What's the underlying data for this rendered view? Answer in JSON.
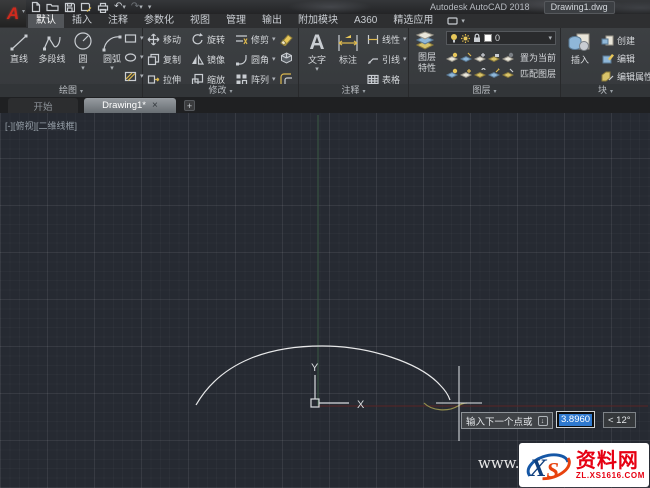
{
  "icons": {
    "logo_a": "A",
    "caret": "▾",
    "undo": "↶",
    "redo": "↷",
    "close": "×",
    "plus": "+",
    "down_arrow": "↓"
  },
  "title_bar": {
    "app_title": "Autodesk AutoCAD 2018",
    "doc_title": "Drawing1.dwg"
  },
  "ribbon_tabs": {
    "home": "默认",
    "insert": "插入",
    "annotate": "注释",
    "parametric": "参数化",
    "view": "视图",
    "manage": "管理",
    "output": "输出",
    "addins": "附加模块",
    "a360": "A360",
    "featured": "精选应用"
  },
  "panels": {
    "draw": {
      "label": "绘图",
      "line": "直线",
      "polyline": "多段线",
      "circle": "圆",
      "arc": "圆弧"
    },
    "modify": {
      "label": "修改",
      "move": "移动",
      "rotate": "旋转",
      "trim": "修剪",
      "copy": "复制",
      "mirror": "镜像",
      "fillet": "圆角",
      "stretch": "拉伸",
      "scale": "缩放",
      "array": "阵列"
    },
    "annotation": {
      "label": "注释",
      "text": "文字",
      "dimension": "标注",
      "linear": "线性",
      "leader": "引线",
      "table": "表格"
    },
    "layers": {
      "label": "图层",
      "props_line1": "图层",
      "props_line2": "特性",
      "layer_name": "0",
      "set_current": "置为当前",
      "match_layer": "匹配图层"
    },
    "block": {
      "label": "块",
      "insert": "插入",
      "create": "创建",
      "edit": "编辑",
      "edit_attrs": "编辑属性"
    }
  },
  "file_tabs": {
    "start": "开始",
    "drawing": "Drawing1*"
  },
  "viewport_label": "[-][俯视][二维线框]",
  "ucs": {
    "x": "X",
    "y": "Y"
  },
  "dynamic_input": {
    "prompt": "输入下一个点或",
    "value": "3.8960",
    "angle": "< 12°"
  },
  "watermark": {
    "prefix": "www.",
    "logo_x": "X",
    "logo_s": "S",
    "site_name": "资料网",
    "site_url": "ZL.XS1616.COM"
  },
  "colors": {
    "canvas_bg": "#262a32",
    "selection_blue": "#2f79cf",
    "axis_x_red": "#5a2424",
    "axis_y_green": "#3a5a44",
    "arc_white": "#e8e9ea",
    "preview_olive": "#938d4d"
  }
}
